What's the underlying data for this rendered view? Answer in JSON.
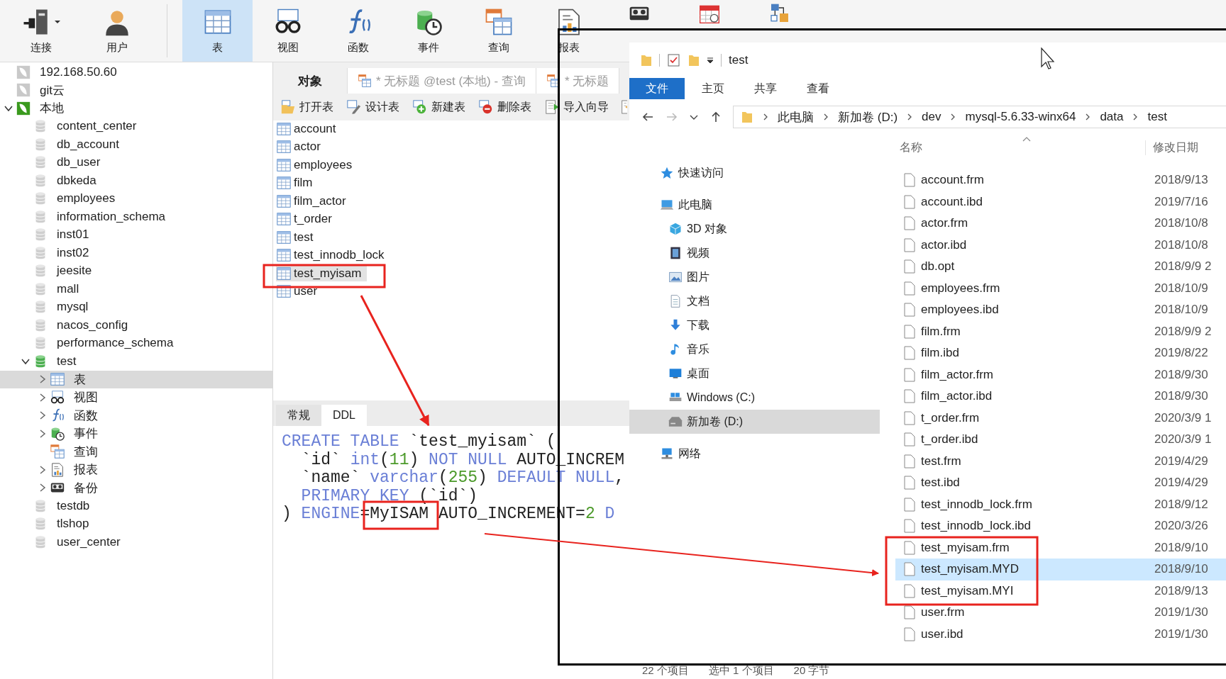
{
  "toolbar": [
    {
      "kind": "connect",
      "label": "连接",
      "dropdown": true,
      "selected": false
    },
    {
      "kind": "user",
      "label": "用户",
      "dropdown": false,
      "selected": false
    },
    {
      "kind": "table",
      "label": "表",
      "dropdown": false,
      "selected": true
    },
    {
      "kind": "view",
      "label": "视图",
      "dropdown": false,
      "selected": false
    },
    {
      "kind": "function",
      "label": "函数",
      "dropdown": false,
      "selected": false
    },
    {
      "kind": "event",
      "label": "事件",
      "dropdown": false,
      "selected": false
    },
    {
      "kind": "query",
      "label": "查询",
      "dropdown": false,
      "selected": false
    },
    {
      "kind": "report",
      "label": "报表",
      "dropdown": false,
      "selected": false
    },
    {
      "kind": "backup",
      "dropdown": false,
      "selected": false
    },
    {
      "kind": "schedule",
      "dropdown": false,
      "selected": false
    },
    {
      "kind": "model",
      "dropdown": false,
      "selected": false
    }
  ],
  "tree": [
    {
      "label": "192.168.50.60",
      "kind": "connection",
      "connected": false,
      "expandable": false,
      "selected": false
    },
    {
      "label": "git云",
      "kind": "connection",
      "connected": false,
      "expandable": false,
      "selected": false
    },
    {
      "label": "本地",
      "kind": "connection",
      "connected": true,
      "expandable": true,
      "expanded": true,
      "selected": false,
      "children": [
        {
          "label": "content_center",
          "kind": "database",
          "expandable": false,
          "expanded": false,
          "selected": false
        },
        {
          "label": "db_account",
          "kind": "database",
          "expandable": false,
          "expanded": false,
          "selected": false
        },
        {
          "label": "db_user",
          "kind": "database",
          "expandable": false,
          "expanded": false,
          "selected": false
        },
        {
          "label": "dbkeda",
          "kind": "database",
          "expandable": false,
          "expanded": false,
          "selected": false
        },
        {
          "label": "employees",
          "kind": "database",
          "expandable": false,
          "expanded": false,
          "selected": false
        },
        {
          "label": "information_schema",
          "kind": "database",
          "expandable": false,
          "expanded": false,
          "selected": false
        },
        {
          "label": "inst01",
          "kind": "database",
          "expandable": false,
          "expanded": false,
          "selected": false
        },
        {
          "label": "inst02",
          "kind": "database",
          "expandable": false,
          "expanded": false,
          "selected": false
        },
        {
          "label": "jeesite",
          "kind": "database",
          "expandable": false,
          "expanded": false,
          "selected": false
        },
        {
          "label": "mall",
          "kind": "database",
          "expandable": false,
          "expanded": false,
          "selected": false
        },
        {
          "label": "mysql",
          "kind": "database",
          "expandable": false,
          "expanded": false,
          "selected": false
        },
        {
          "label": "nacos_config",
          "kind": "database",
          "expandable": false,
          "expanded": false,
          "selected": false
        },
        {
          "label": "performance_schema",
          "kind": "database",
          "expandable": false,
          "expanded": false,
          "selected": false
        },
        {
          "label": "test",
          "kind": "database",
          "expandable": true,
          "expanded": true,
          "selected": false,
          "children": [
            {
              "label": "表",
              "kind": "table",
              "expandable": true,
              "expanded": false,
              "selected": true
            },
            {
              "label": "视图",
              "kind": "view",
              "expandable": true,
              "expanded": false,
              "selected": false
            },
            {
              "label": "函数",
              "kind": "function",
              "expandable": true,
              "expanded": false,
              "selected": false
            },
            {
              "label": "事件",
              "kind": "event",
              "expandable": true,
              "expanded": false,
              "selected": false
            },
            {
              "label": "查询",
              "kind": "query",
              "expandable": false,
              "expanded": false,
              "selected": false
            },
            {
              "label": "报表",
              "kind": "report",
              "expandable": true,
              "expanded": false,
              "selected": false
            },
            {
              "label": "备份",
              "kind": "backup",
              "expandable": true,
              "expanded": false,
              "selected": false
            }
          ]
        },
        {
          "label": "testdb",
          "kind": "database",
          "expandable": false,
          "expanded": false,
          "selected": false
        },
        {
          "label": "tlshop",
          "kind": "database",
          "expandable": false,
          "expanded": false,
          "selected": false
        },
        {
          "label": "user_center",
          "kind": "database",
          "expandable": false,
          "expanded": false,
          "selected": false
        }
      ]
    }
  ],
  "editor_tabs": [
    {
      "kind": "objects",
      "label": "对象",
      "selected": true
    },
    {
      "kind": "query",
      "label": "* 无标题 @test (本地) - 查询",
      "selected": false
    },
    {
      "kind": "query",
      "label": "* 无标题",
      "selected": false
    }
  ],
  "object_toolbar": [
    {
      "kind": "open",
      "label": "打开表"
    },
    {
      "kind": "design",
      "label": "设计表"
    },
    {
      "kind": "new",
      "label": "新建表"
    },
    {
      "kind": "delete",
      "label": "删除表"
    },
    {
      "kind": "import",
      "label": "导入向导"
    },
    {
      "kind": "export"
    }
  ],
  "tables": [
    {
      "name": "account",
      "selected": false
    },
    {
      "name": "actor",
      "selected": false
    },
    {
      "name": "employees",
      "selected": false
    },
    {
      "name": "film",
      "selected": false
    },
    {
      "name": "film_actor",
      "selected": false
    },
    {
      "name": "t_order",
      "selected": false
    },
    {
      "name": "test",
      "selected": false
    },
    {
      "name": "test_innodb_lock",
      "selected": false
    },
    {
      "name": "test_myisam",
      "selected": true
    },
    {
      "name": "user",
      "selected": false
    }
  ],
  "detail_tabs": [
    {
      "label": "常规",
      "selected": false
    },
    {
      "label": "DDL",
      "selected": true
    }
  ],
  "ddl": [
    [
      {
        "text": "CREATE TABLE",
        "kind": "keyword"
      },
      {
        "text": " `test_myisam` (",
        "kind": "plain"
      }
    ],
    [
      {
        "text": "  `id` ",
        "kind": "plain"
      },
      {
        "text": "int",
        "kind": "keyword"
      },
      {
        "text": "(",
        "kind": "plain"
      },
      {
        "text": "11",
        "kind": "number"
      },
      {
        "text": ") ",
        "kind": "plain"
      },
      {
        "text": "NOT NULL",
        "kind": "keyword"
      },
      {
        "text": " AUTO_INCREM",
        "kind": "plain"
      }
    ],
    [
      {
        "text": "  `name` ",
        "kind": "plain"
      },
      {
        "text": "varchar",
        "kind": "keyword"
      },
      {
        "text": "(",
        "kind": "plain"
      },
      {
        "text": "255",
        "kind": "number"
      },
      {
        "text": ") ",
        "kind": "plain"
      },
      {
        "text": "DEFAULT NULL",
        "kind": "keyword"
      },
      {
        "text": ",",
        "kind": "plain"
      }
    ],
    [
      {
        "text": "  PRIMARY KEY",
        "kind": "keyword"
      },
      {
        "text": " (`id`)",
        "kind": "plain"
      }
    ],
    [
      {
        "text": ") ",
        "kind": "plain"
      },
      {
        "text": "ENGINE",
        "kind": "keyword"
      },
      {
        "text": "=",
        "kind": "plain"
      },
      {
        "text": "MyISAM",
        "kind": "plain"
      },
      {
        "text": " AUTO_INCREMENT=",
        "kind": "plain"
      },
      {
        "text": "2",
        "kind": "number"
      },
      {
        "text": " D",
        "kind": "keyword"
      }
    ]
  ],
  "explorer": {
    "title": "test",
    "ribbon": [
      {
        "label": "文件",
        "kind": "file-menu"
      },
      {
        "label": "主页",
        "kind": "tab"
      },
      {
        "label": "共享",
        "kind": "tab"
      },
      {
        "label": "查看",
        "kind": "tab"
      }
    ],
    "address": [
      "此电脑",
      "新加卷 (D:)",
      "dev",
      "mysql-5.6.33-winx64",
      "data",
      "test"
    ],
    "nav": [
      {
        "label": "快速访问",
        "kind": "quick-access",
        "selected": false
      },
      {
        "label": "此电脑",
        "kind": "pc",
        "selected": false,
        "children": [
          {
            "label": "3D 对象",
            "kind": "objects-3d",
            "selected": false
          },
          {
            "label": "视频",
            "kind": "video",
            "selected": false
          },
          {
            "label": "图片",
            "kind": "pictures",
            "selected": false
          },
          {
            "label": "文档",
            "kind": "documents",
            "selected": false
          },
          {
            "label": "下载",
            "kind": "downloads",
            "selected": false
          },
          {
            "label": "音乐",
            "kind": "music",
            "selected": false
          },
          {
            "label": "桌面",
            "kind": "desktop",
            "selected": false
          },
          {
            "label": "Windows (C:)",
            "kind": "system-drive",
            "selected": false
          },
          {
            "label": "新加卷 (D:)",
            "kind": "drive",
            "selected": true
          }
        ]
      },
      {
        "label": "网络",
        "kind": "network",
        "selected": false
      }
    ],
    "columns": [
      "名称",
      "修改日期"
    ],
    "files": [
      {
        "name": "account.frm",
        "date": "2018/9/13",
        "selected": false
      },
      {
        "name": "account.ibd",
        "date": "2019/7/16",
        "selected": false
      },
      {
        "name": "actor.frm",
        "date": "2018/10/8",
        "selected": false
      },
      {
        "name": "actor.ibd",
        "date": "2018/10/8",
        "selected": false
      },
      {
        "name": "db.opt",
        "date": "2018/9/9 2",
        "selected": false
      },
      {
        "name": "employees.frm",
        "date": "2018/10/9",
        "selected": false
      },
      {
        "name": "employees.ibd",
        "date": "2018/10/9",
        "selected": false
      },
      {
        "name": "film.frm",
        "date": "2018/9/9 2",
        "selected": false
      },
      {
        "name": "film.ibd",
        "date": "2019/8/22",
        "selected": false
      },
      {
        "name": "film_actor.frm",
        "date": "2018/9/30",
        "selected": false
      },
      {
        "name": "film_actor.ibd",
        "date": "2018/9/30",
        "selected": false
      },
      {
        "name": "t_order.frm",
        "date": "2020/3/9 1",
        "selected": false
      },
      {
        "name": "t_order.ibd",
        "date": "2020/3/9 1",
        "selected": false
      },
      {
        "name": "test.frm",
        "date": "2019/4/29",
        "selected": false
      },
      {
        "name": "test.ibd",
        "date": "2019/4/29",
        "selected": false
      },
      {
        "name": "test_innodb_lock.frm",
        "date": "2018/9/12",
        "selected": false
      },
      {
        "name": "test_innodb_lock.ibd",
        "date": "2020/3/26",
        "selected": false
      },
      {
        "name": "test_myisam.frm",
        "date": "2018/9/10",
        "selected": false
      },
      {
        "name": "test_myisam.MYD",
        "date": "2018/9/10",
        "selected": true
      },
      {
        "name": "test_myisam.MYI",
        "date": "2018/9/13",
        "selected": false
      },
      {
        "name": "user.frm",
        "date": "2019/1/30",
        "selected": false
      },
      {
        "name": "user.ibd",
        "date": "2019/1/30",
        "selected": false
      }
    ],
    "status_bar": [
      "22 个项目",
      "选中 1 个项目",
      "20 字节"
    ]
  }
}
